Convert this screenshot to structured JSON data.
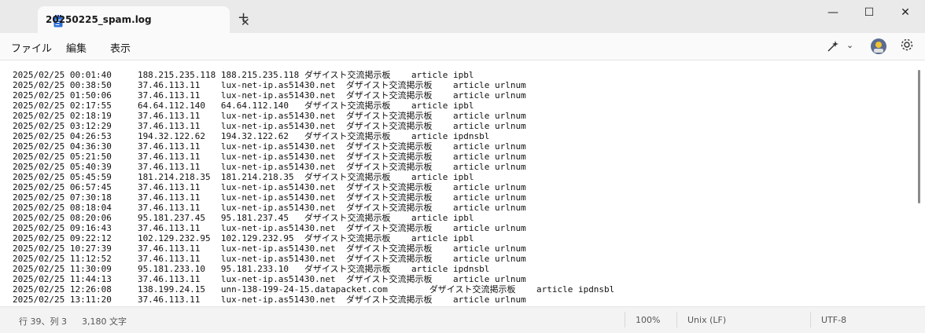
{
  "tab": {
    "title": "20250225_spam.log"
  },
  "window": {
    "minimize": "—",
    "maximize": "☐",
    "close": "✕"
  },
  "menu": {
    "file": "ファイル",
    "edit": "編集",
    "view": "表示"
  },
  "log": {
    "lines": [
      "2025/02/25 00:01:40     188.215.235.118 188.215.235.118 ダザイスト交流掲示板    article ipbl",
      "2025/02/25 00:38:50     37.46.113.11    lux-net-ip.as51430.net  ダザイスト交流掲示板    article urlnum",
      "2025/02/25 01:50:06     37.46.113.11    lux-net-ip.as51430.net  ダザイスト交流掲示板    article urlnum",
      "2025/02/25 02:17:55     64.64.112.140   64.64.112.140   ダザイスト交流掲示板    article ipbl",
      "2025/02/25 02:18:19     37.46.113.11    lux-net-ip.as51430.net  ダザイスト交流掲示板    article urlnum",
      "2025/02/25 03:12:29     37.46.113.11    lux-net-ip.as51430.net  ダザイスト交流掲示板    article urlnum",
      "2025/02/25 04:26:53     194.32.122.62   194.32.122.62   ダザイスト交流掲示板    article ipdnsbl",
      "2025/02/25 04:36:30     37.46.113.11    lux-net-ip.as51430.net  ダザイスト交流掲示板    article urlnum",
      "2025/02/25 05:21:50     37.46.113.11    lux-net-ip.as51430.net  ダザイスト交流掲示板    article urlnum",
      "2025/02/25 05:40:39     37.46.113.11    lux-net-ip.as51430.net  ダザイスト交流掲示板    article urlnum",
      "2025/02/25 05:45:59     181.214.218.35  181.214.218.35  ダザイスト交流掲示板    article ipbl",
      "2025/02/25 06:57:45     37.46.113.11    lux-net-ip.as51430.net  ダザイスト交流掲示板    article urlnum",
      "2025/02/25 07:30:18     37.46.113.11    lux-net-ip.as51430.net  ダザイスト交流掲示板    article urlnum",
      "2025/02/25 08:18:04     37.46.113.11    lux-net-ip.as51430.net  ダザイスト交流掲示板    article urlnum",
      "2025/02/25 08:20:06     95.181.237.45   95.181.237.45   ダザイスト交流掲示板    article ipbl",
      "2025/02/25 09:16:43     37.46.113.11    lux-net-ip.as51430.net  ダザイスト交流掲示板    article urlnum",
      "2025/02/25 09:22:12     102.129.232.95  102.129.232.95  ダザイスト交流掲示板    article ipbl",
      "2025/02/25 10:27:39     37.46.113.11    lux-net-ip.as51430.net  ダザイスト交流掲示板    article urlnum",
      "2025/02/25 11:12:52     37.46.113.11    lux-net-ip.as51430.net  ダザイスト交流掲示板    article urlnum",
      "2025/02/25 11:30:09     95.181.233.10   95.181.233.10   ダザイスト交流掲示板    article ipdnsbl",
      "2025/02/25 11:44:13     37.46.113.11    lux-net-ip.as51430.net  ダザイスト交流掲示板    article urlnum",
      "2025/02/25 12:26:08     138.199.24.15   unn-138-199-24-15.datapacket.com        ダザイスト交流掲示板    article ipdnsbl",
      "2025/02/25 13:11:20     37.46.113.11    lux-net-ip.as51430.net  ダザイスト交流掲示板    article urlnum"
    ]
  },
  "status": {
    "position": "行 39、列 3",
    "chars": "3,180 文字",
    "zoom": "100%",
    "line_ending": "Unix (LF)",
    "encoding": "UTF-8"
  },
  "colors": {
    "accent": "#1a73e8"
  },
  "icons": [
    "notepad-icon",
    "close-icon",
    "plus-icon",
    "minimize-icon",
    "maximize-icon",
    "copilot-icon",
    "chevron-down-icon",
    "avatar",
    "gear-icon"
  ]
}
